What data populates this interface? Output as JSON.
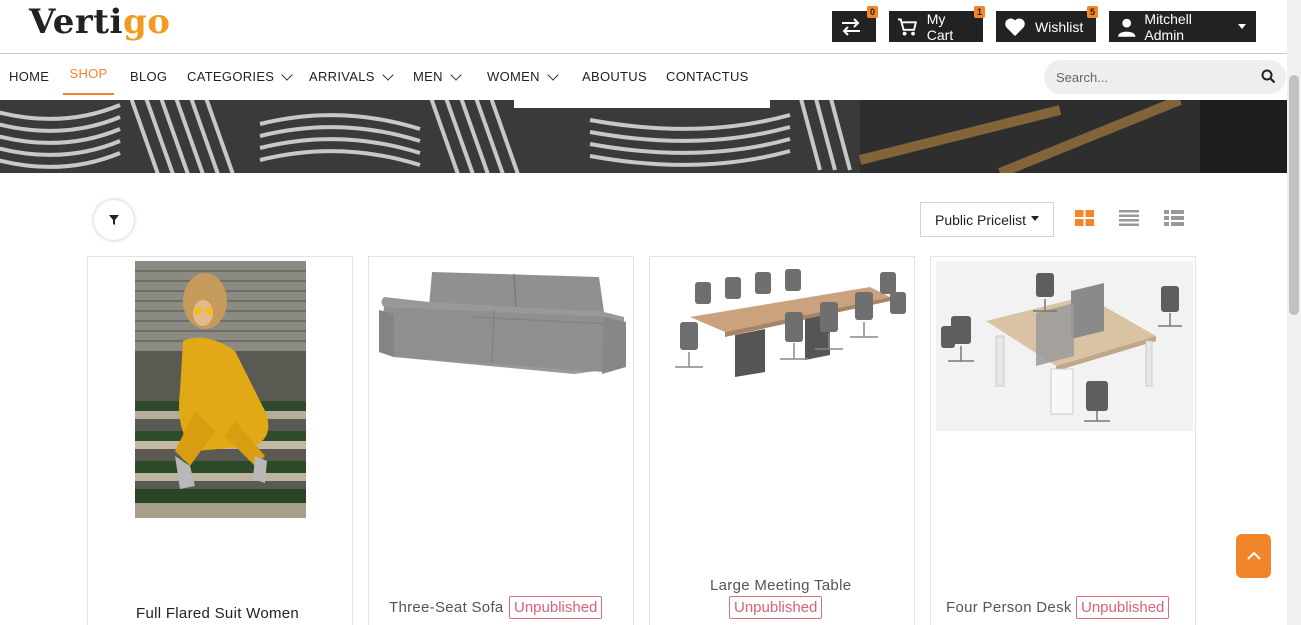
{
  "brand": {
    "logo_prefix": "Verti",
    "logo_suffix": "go"
  },
  "header": {
    "compare": {
      "count": "0"
    },
    "cart": {
      "label": "My Cart",
      "count": "1"
    },
    "wishlist": {
      "label": "Wishlist",
      "count": "5"
    },
    "user": {
      "name": "Mitchell Admin"
    }
  },
  "nav": {
    "items": [
      {
        "label": "HOME"
      },
      {
        "label": "SHOP"
      },
      {
        "label": "BLOG"
      },
      {
        "label": "CATEGORIES"
      },
      {
        "label": "ARRIVALS"
      },
      {
        "label": "MEN"
      },
      {
        "label": "WOMEN"
      },
      {
        "label": "ABOUTUS"
      },
      {
        "label": "CONTACTUS"
      }
    ],
    "active": "SHOP"
  },
  "search": {
    "placeholder": "Search..."
  },
  "toolbar": {
    "pricelist": "Public Pricelist"
  },
  "products": [
    {
      "name": "Full Flared Suit Women"
    },
    {
      "name": "Three-Seat Sofa",
      "status": "Unpublished"
    },
    {
      "name": "Large Meeting Table",
      "status": "Unpublished"
    },
    {
      "name": "Four Person Desk",
      "status": "Unpublished"
    }
  ],
  "colors": {
    "accent": "#f2852b",
    "dark": "#222222",
    "unpublished": "#d9617a"
  }
}
